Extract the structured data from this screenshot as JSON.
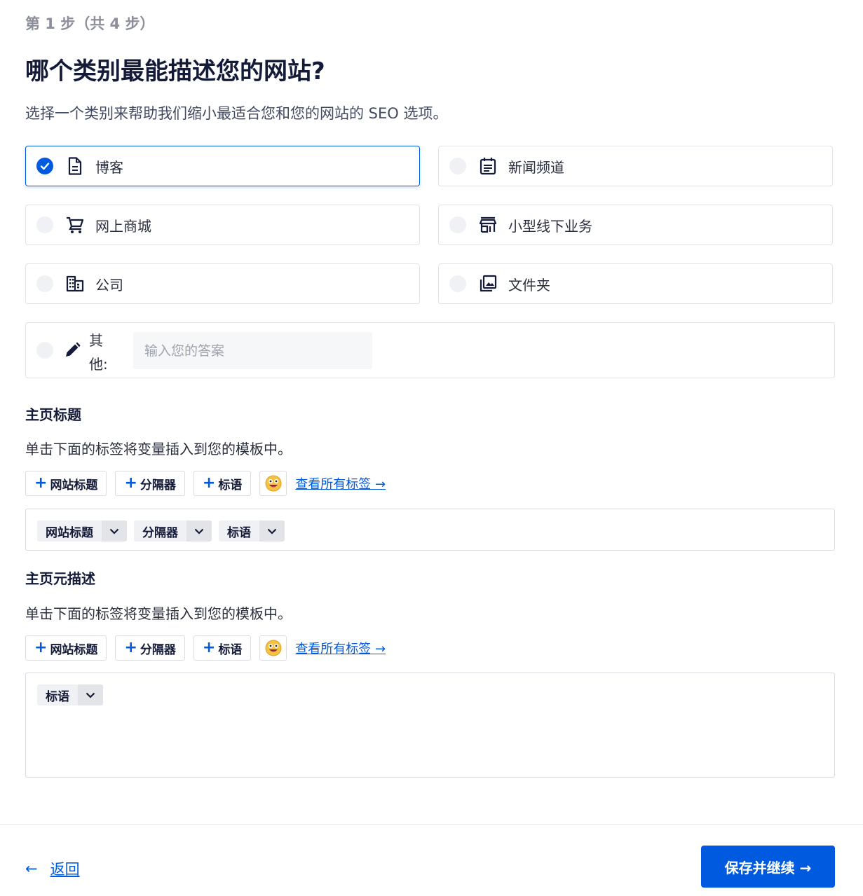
{
  "step": "第 1 步（共 4 步）",
  "title": "哪个类别最能描述您的网站?",
  "subtitle": "选择一个类别来帮助我们缩小最适合您和您的网站的 SEO 选项。",
  "categories": [
    {
      "label": "博客",
      "icon": "document-icon",
      "selected": true
    },
    {
      "label": "新闻频道",
      "icon": "newspaper-icon",
      "selected": false
    },
    {
      "label": "网上商城",
      "icon": "shopping-cart-icon",
      "selected": false
    },
    {
      "label": "小型线下业务",
      "icon": "storefront-icon",
      "selected": false
    },
    {
      "label": "公司",
      "icon": "building-icon",
      "selected": false
    },
    {
      "label": "文件夹",
      "icon": "gallery-icon",
      "selected": false
    }
  ],
  "other": {
    "label": "其他:",
    "placeholder": "输入您的答案",
    "icon": "pencil-icon"
  },
  "home_title": {
    "heading": "主页标题",
    "description": "单击下面的标签将变量插入到您的模板中。",
    "tag_buttons": [
      "网站标题",
      "分隔器",
      "标语"
    ],
    "view_all": "查看所有标签 →",
    "chips": [
      "网站标题",
      "分隔器",
      "标语"
    ]
  },
  "home_meta": {
    "heading": "主页元描述",
    "description": "单击下面的标签将变量插入到您的模板中。",
    "tag_buttons": [
      "网站标题",
      "分隔器",
      "标语"
    ],
    "view_all": "查看所有标签 →",
    "chips": [
      "标语"
    ]
  },
  "footer": {
    "back_arrow": "←",
    "back_label": "返回",
    "save_label": "保存并继续 →"
  },
  "colors": {
    "accent": "#005ae0",
    "text": "#141b38",
    "muted": "#8c8f9a"
  }
}
